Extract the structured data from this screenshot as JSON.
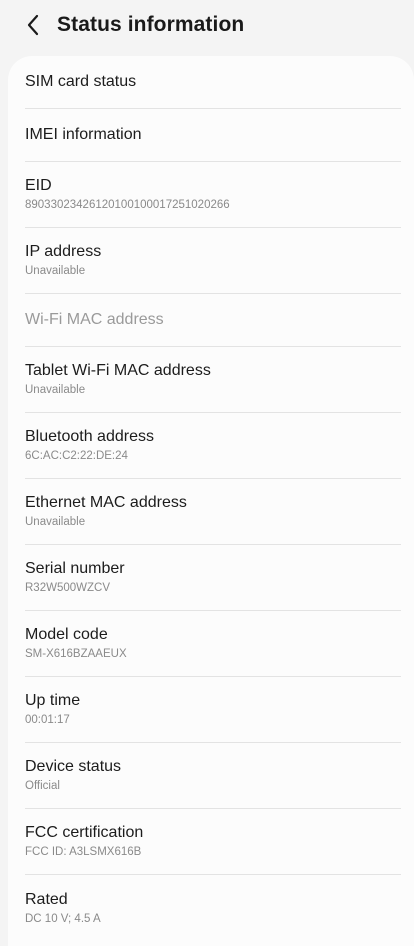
{
  "header": {
    "title": "Status information"
  },
  "items": [
    {
      "label": "SIM card status",
      "value": ""
    },
    {
      "label": "IMEI information",
      "value": ""
    },
    {
      "label": "EID",
      "value": "89033023426120100100017251020266"
    },
    {
      "label": "IP address",
      "value": "Unavailable"
    },
    {
      "label": "Wi-Fi MAC address",
      "value": "",
      "disabled": true
    },
    {
      "label": "Tablet Wi-Fi MAC address",
      "value": "Unavailable"
    },
    {
      "label": "Bluetooth address",
      "value": "6C:AC:C2:22:DE:24"
    },
    {
      "label": "Ethernet MAC address",
      "value": "Unavailable"
    },
    {
      "label": "Serial number",
      "value": "R32W500WZCV"
    },
    {
      "label": "Model code",
      "value": "SM-X616BZAAEUX"
    },
    {
      "label": "Up time",
      "value": "00:01:17"
    },
    {
      "label": "Device status",
      "value": "Official"
    },
    {
      "label": "FCC certification",
      "value": "FCC ID: A3LSMX616B"
    },
    {
      "label": "Rated",
      "value": "DC 10 V; 4.5 A"
    }
  ],
  "icons": {
    "back": "chevron-left-icon"
  },
  "colors": {
    "background": "#f4f4f4",
    "card": "#fcfcfc",
    "primary_text": "#1c1c1c",
    "secondary_text": "#8a8a8a",
    "disabled_text": "#9a9a9a",
    "divider": "#e3e3e3"
  }
}
